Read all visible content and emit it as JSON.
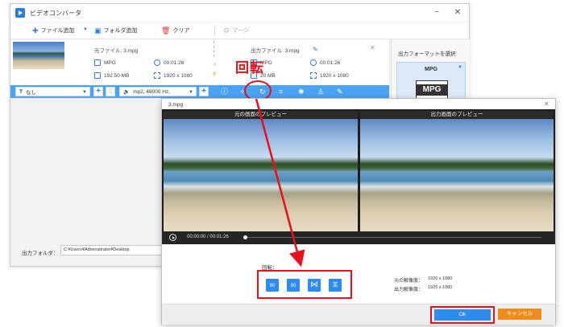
{
  "app": {
    "title": "ビデオコンバータ"
  },
  "window_controls": {
    "minimize": "−",
    "close": "✕"
  },
  "toolbar": {
    "add_file": "ファイル追加",
    "add_folder": "フォルダ追加",
    "clear": "クリア",
    "merge": "マージ"
  },
  "file_row": {
    "source_label": "元ファイル: 3.mpg",
    "source_format": "MPG",
    "source_duration": "00:01:26",
    "source_size": "192.50 MB",
    "source_resolution": "1920 x 1080",
    "output_label": "出力ファイル: 3.mpg",
    "output_format": "MPG",
    "output_duration": "00:01:26",
    "output_size": "20 MB",
    "output_resolution": "1920 x 1080"
  },
  "edit_bar": {
    "subtitle_select": "なし",
    "audio_select": "mp2, 48000 Hz,"
  },
  "right_panel": {
    "format_label": "出力フォーマットを選択",
    "format_name": "MPG",
    "format_icon_text": "MPG"
  },
  "footer": {
    "output_folder_label": "出力フォルダ：",
    "output_folder_path": "C:¥Users¥Administrator¥Desktop"
  },
  "annotation": {
    "text": "回転"
  },
  "dialog": {
    "title": "3.mpg",
    "close": "✕",
    "original_preview_label": "元の画面のプレビュー",
    "output_preview_label": "出力画面のプレビュー",
    "time_current": "00:00:00",
    "time_sep": "/",
    "time_total": "00:01:26",
    "seek_position": 0.0,
    "rotate_label": "回転：",
    "rotate_buttons": [
      "90",
      "90",
      "⋈",
      "⧖"
    ],
    "orig_resolution_label": "元の解像度：",
    "orig_resolution_value": "1920 x 1080",
    "out_resolution_label": "出力解像度：",
    "out_resolution_value": "1920 x 1080",
    "ok": "Ok",
    "cancel": "キャンセル"
  },
  "colors": {
    "accent_blue": "#2d8cf0",
    "edit_bar_blue": "#4aa3f2",
    "annotation_red": "#e8101a",
    "cancel_orange": "#f08c1a"
  },
  "icons": {
    "toolbar": [
      "plus-icon",
      "folder-plus-icon",
      "trash-icon",
      "merge-icon"
    ],
    "edit_bar": [
      "info-icon",
      "sparkle-icon",
      "rotate-icon",
      "crop-icon",
      "effects-icon",
      "watermark-icon",
      "edit-icon"
    ]
  }
}
